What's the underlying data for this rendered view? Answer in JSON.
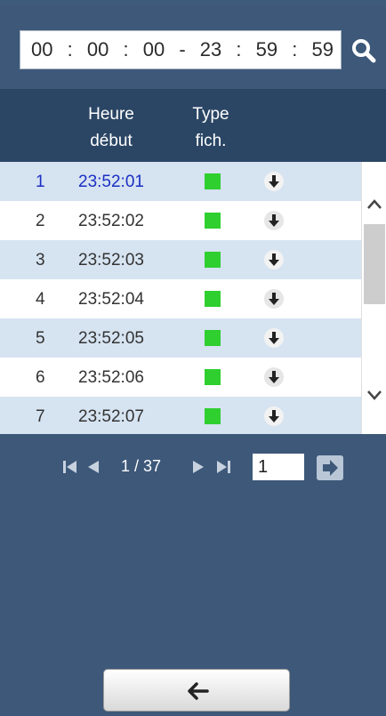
{
  "time_filter": {
    "start_hh": "00",
    "start_mm": "00",
    "start_ss": "00",
    "sep_colon": ":",
    "sep_range": "-",
    "end_hh": "23",
    "end_mm": "59",
    "end_ss": "59"
  },
  "table": {
    "col_heure_line1": "Heure",
    "col_heure_line2": "début",
    "col_type_line1": "Type",
    "col_type_line2": "fich.",
    "rows": [
      {
        "num": "1",
        "time": "23:52:01"
      },
      {
        "num": "2",
        "time": "23:52:02"
      },
      {
        "num": "3",
        "time": "23:52:03"
      },
      {
        "num": "4",
        "time": "23:52:04"
      },
      {
        "num": "5",
        "time": "23:52:05"
      },
      {
        "num": "6",
        "time": "23:52:06"
      },
      {
        "num": "7",
        "time": "23:52:07"
      }
    ]
  },
  "pager": {
    "page_status": "1 / 37",
    "page_input": "1"
  },
  "colors": {
    "background": "#3d5879",
    "header": "#2b4665",
    "row_alt": "#d6e3f1",
    "type_marker": "#2fcf2f",
    "selected_text": "#1a2fc4"
  },
  "icons": {
    "search": "search-icon",
    "download": "download-icon",
    "first": "first-page-icon",
    "prev": "prev-page-icon",
    "next": "next-page-icon",
    "last": "last-page-icon",
    "go": "go-arrow-icon",
    "back": "back-arrow-icon"
  }
}
